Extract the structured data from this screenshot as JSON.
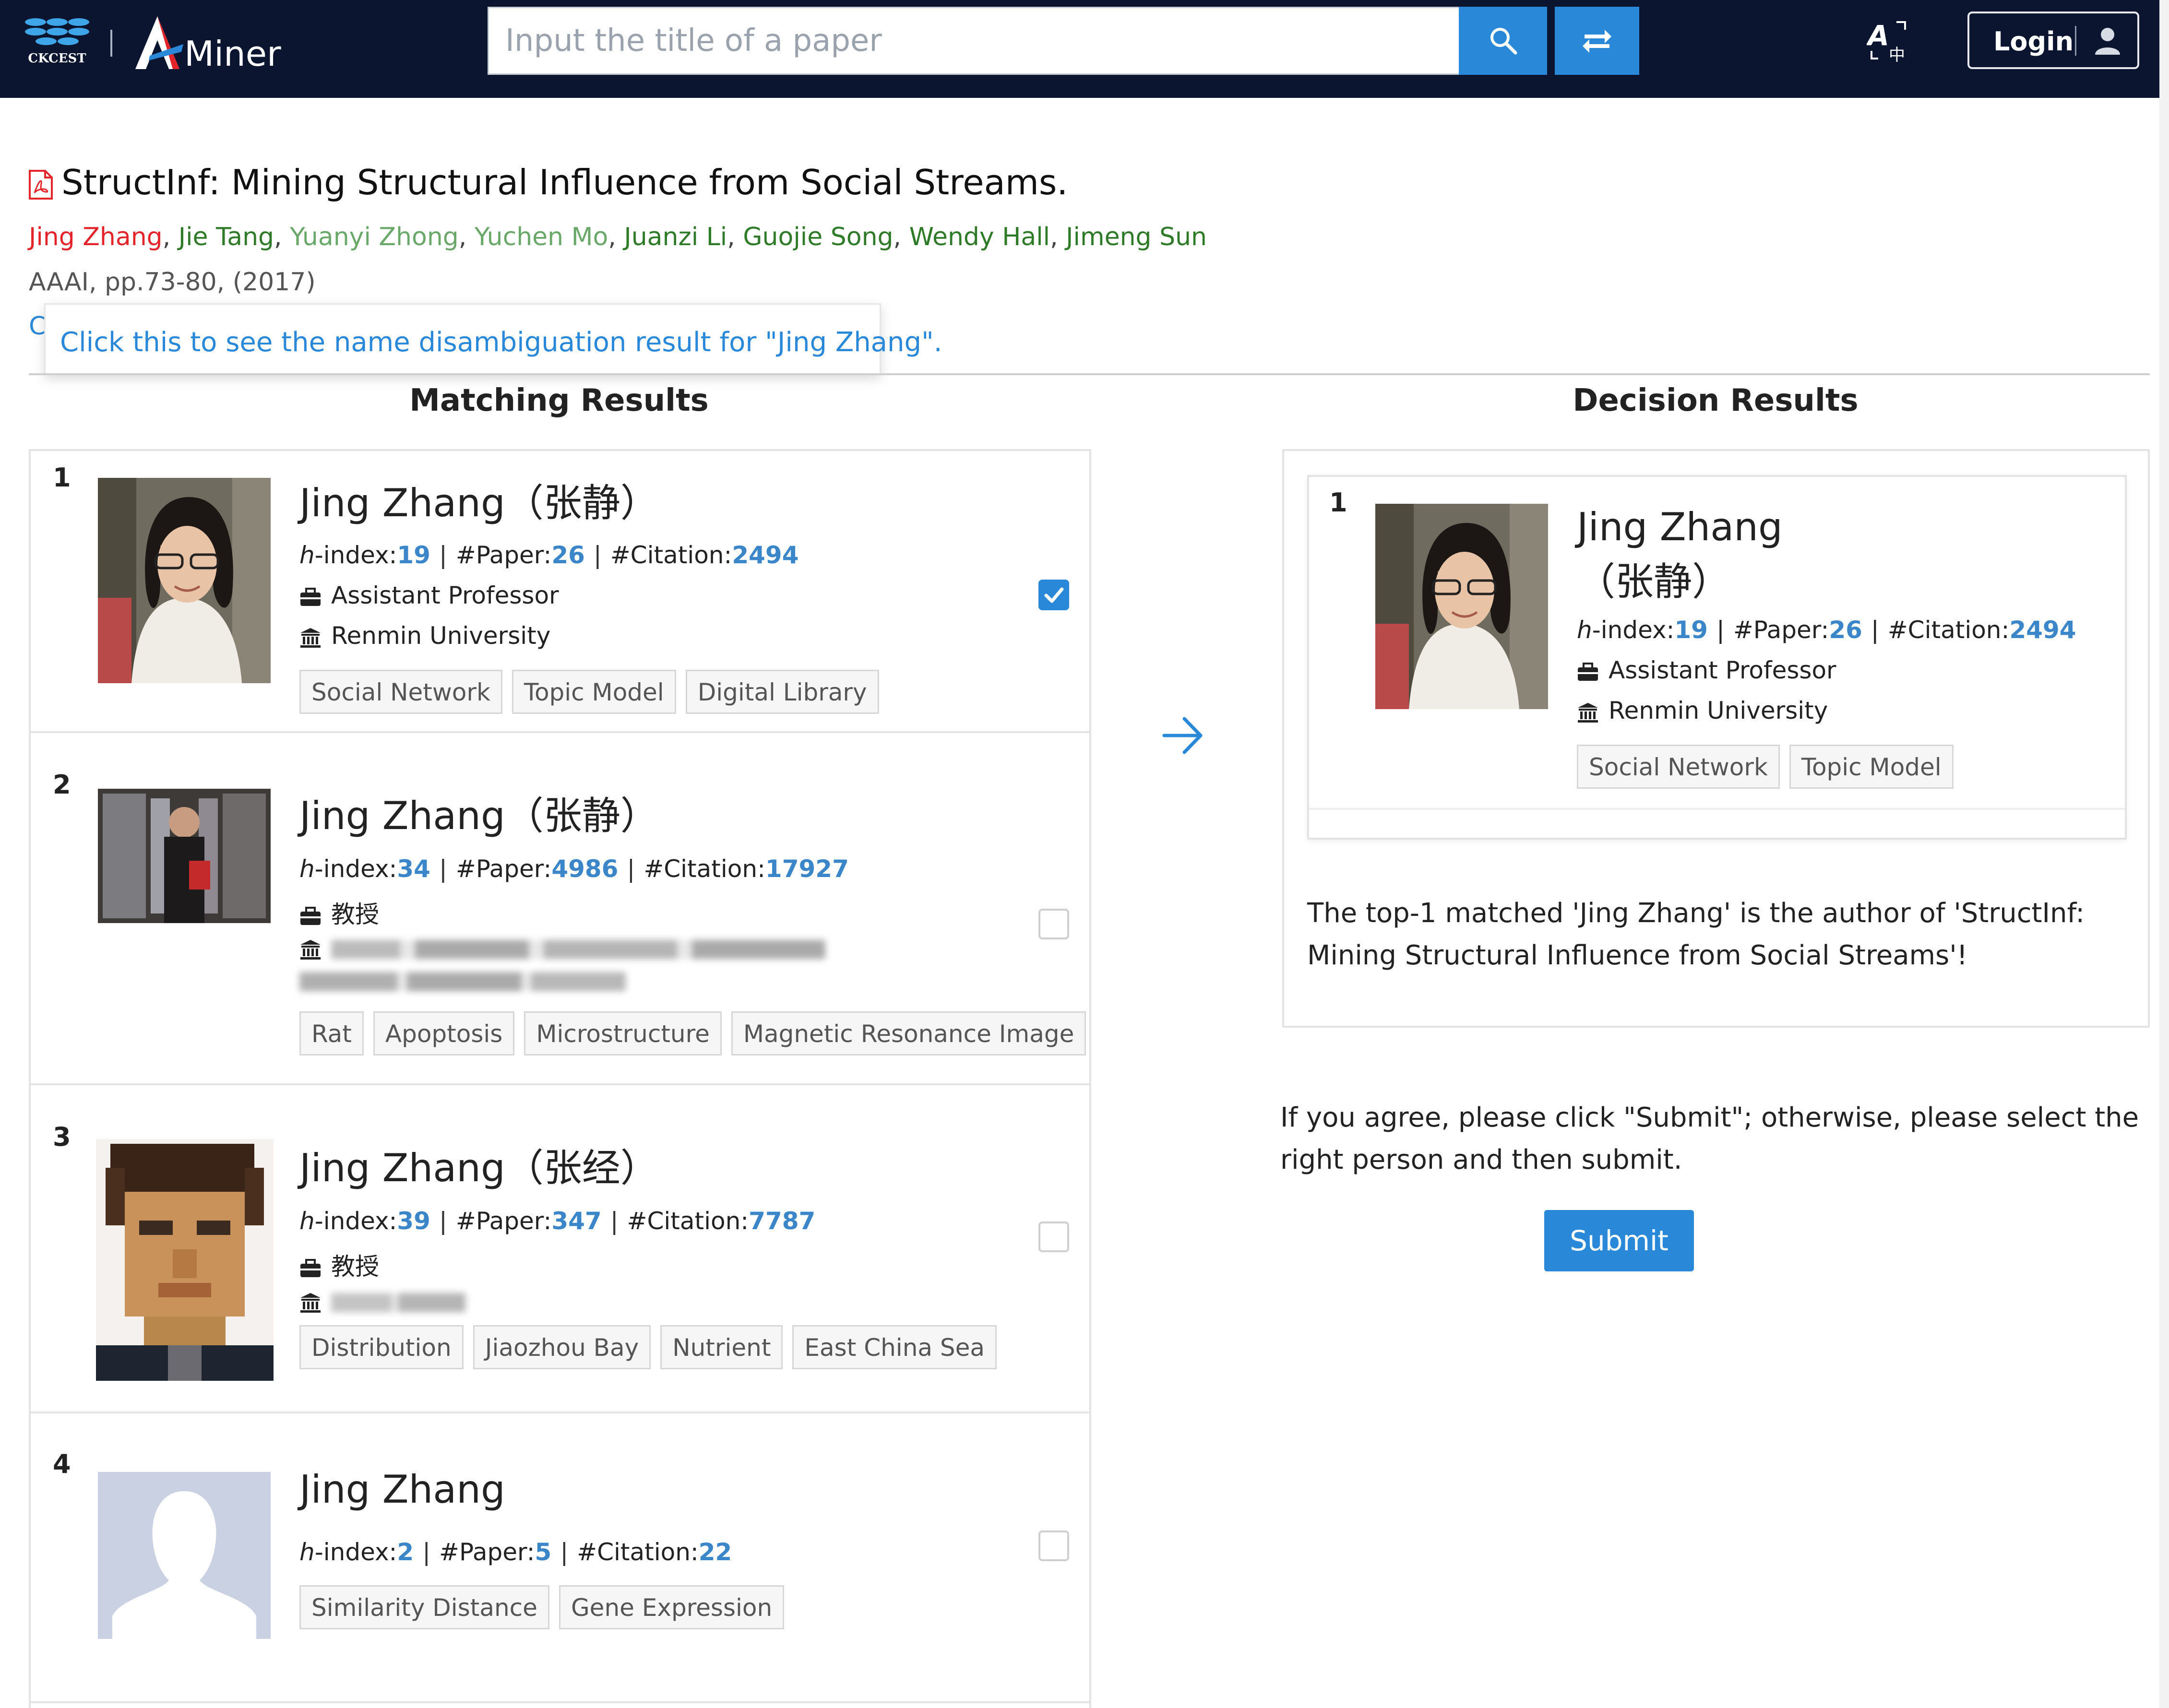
{
  "header": {
    "ckcest_logo_text": "CKCEST",
    "aminer_logo_text": "Miner",
    "search": {
      "placeholder": "Input the title of a paper",
      "value": ""
    },
    "login_label": "Login"
  },
  "paper": {
    "title": "StructInf: Mining Structural Influence from Social Streams.",
    "authors": [
      {
        "name": "Jing Zhang",
        "style": "red"
      },
      {
        "name": "Jie Tang",
        "style": "dark"
      },
      {
        "name": "Yuanyi Zhong",
        "style": "light"
      },
      {
        "name": "Yuchen Mo",
        "style": "light"
      },
      {
        "name": "Juanzi Li",
        "style": "dark"
      },
      {
        "name": "Guojie Song",
        "style": "dark"
      },
      {
        "name": "Wendy Hall",
        "style": "dark"
      },
      {
        "name": "Jimeng Sun",
        "style": "dark"
      }
    ],
    "venue": "AAAI, pp.73-80, (2017)",
    "hidden_prefix": "C"
  },
  "tooltip": "Click this to see the name disambiguation result for \"Jing Zhang\".",
  "matching": {
    "heading": "Matching Results",
    "candidates": [
      {
        "rank": "1",
        "name": "Jing Zhang（张静）",
        "stats": {
          "h_label": "h",
          "h_suffix": "-index:",
          "h_index": "19",
          "paper_label": "#Paper:",
          "papers": "26",
          "citation_label": "#Citation:",
          "citations": "2494"
        },
        "position": "Assistant Professor",
        "affiliation": "Renmin University",
        "tags": [
          "Social Network",
          "Topic Model",
          "Digital Library"
        ],
        "checked": true
      },
      {
        "rank": "2",
        "name": "Jing Zhang（张静）",
        "stats": {
          "h_label": "h",
          "h_suffix": "-index:",
          "h_index": "34",
          "paper_label": "#Paper:",
          "papers": "4986",
          "citation_label": "#Citation:",
          "citations": "17927"
        },
        "position": "教授",
        "affiliation": "",
        "tags": [
          "Rat",
          "Apoptosis",
          "Microstructure",
          "Magnetic Resonance Image"
        ],
        "checked": false
      },
      {
        "rank": "3",
        "name": "Jing Zhang（张经）",
        "stats": {
          "h_label": "h",
          "h_suffix": "-index:",
          "h_index": "39",
          "paper_label": "#Paper:",
          "papers": "347",
          "citation_label": "#Citation:",
          "citations": "7787"
        },
        "position": "教授",
        "affiliation": "",
        "tags": [
          "Distribution",
          "Jiaozhou Bay",
          "Nutrient",
          "East China Sea"
        ],
        "checked": false
      },
      {
        "rank": "4",
        "name": "Jing Zhang",
        "stats": {
          "h_label": "h",
          "h_suffix": "-index:",
          "h_index": "2",
          "paper_label": "#Paper:",
          "papers": "5",
          "citation_label": "#Citation:",
          "citations": "22"
        },
        "position": "",
        "affiliation": "",
        "tags": [
          "Similarity Distance",
          "Gene Expression"
        ],
        "checked": false
      }
    ]
  },
  "decision": {
    "heading": "Decision Results",
    "card": {
      "rank": "1",
      "name": "Jing Zhang（张静）",
      "stats": {
        "h_label": "h",
        "h_suffix": "-index:",
        "h_index": "19",
        "paper_label": "#Paper:",
        "papers": "26",
        "citation_label": "#Citation:",
        "citations": "2494"
      },
      "position": "Assistant Professor",
      "affiliation": "Renmin University",
      "tags": [
        "Social Network",
        "Topic Model"
      ]
    },
    "message": "The top-1 matched 'Jing Zhang' is the author of 'StructInf: Mining Structural Influence from Social Streams'!"
  },
  "agree_text": "If you agree, please click \"Submit\"; otherwise, please select the right person and then submit.",
  "submit_label": "Submit",
  "colors": {
    "topbar": "#0b1530",
    "accent": "#2a88d8",
    "author_highlight": "#e3242b",
    "author_link": "#2f7a28",
    "author_link_light": "#6aa86a",
    "stat_value": "#3a86c8"
  },
  "icons": [
    "ckcest-logo",
    "aminer-logo",
    "search-icon",
    "swap-icon",
    "translate-icon",
    "user-icon",
    "pdf-icon",
    "briefcase-icon",
    "institution-icon",
    "check-icon",
    "arrow-right-icon"
  ]
}
